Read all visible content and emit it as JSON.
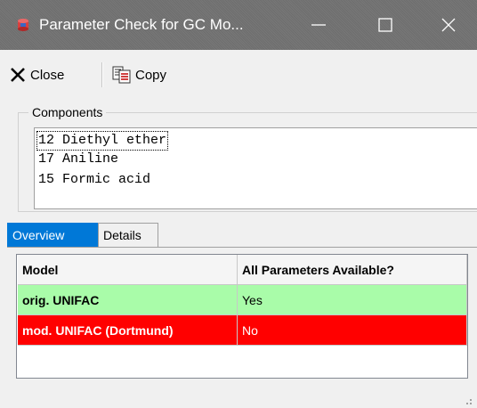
{
  "window": {
    "title": "Parameter Check for GC Mo...",
    "controls": {
      "minimize": "minimize-icon",
      "maximize": "maximize-icon",
      "close": "close-icon"
    }
  },
  "toolbar": {
    "close_label": "Close",
    "copy_label": "Copy"
  },
  "components": {
    "group_title": "Components",
    "items": [
      "12 Diethyl ether",
      "17 Aniline",
      "15 Formic acid"
    ]
  },
  "tabs": [
    {
      "label": "Overview",
      "selected": true
    },
    {
      "label": "Details",
      "selected": false
    }
  ],
  "table": {
    "columns": [
      "Model",
      "All Parameters Available?"
    ],
    "rows": [
      {
        "model": "orig. UNIFAC",
        "available": "Yes",
        "status_color": "#a9fca9"
      },
      {
        "model": "mod. UNIFAC (Dortmund)",
        "available": "No",
        "status_color": "#ff0000"
      }
    ]
  },
  "colors": {
    "selected_tab": "#0078d7",
    "ok": "#a9fca9",
    "missing": "#ff0000"
  }
}
